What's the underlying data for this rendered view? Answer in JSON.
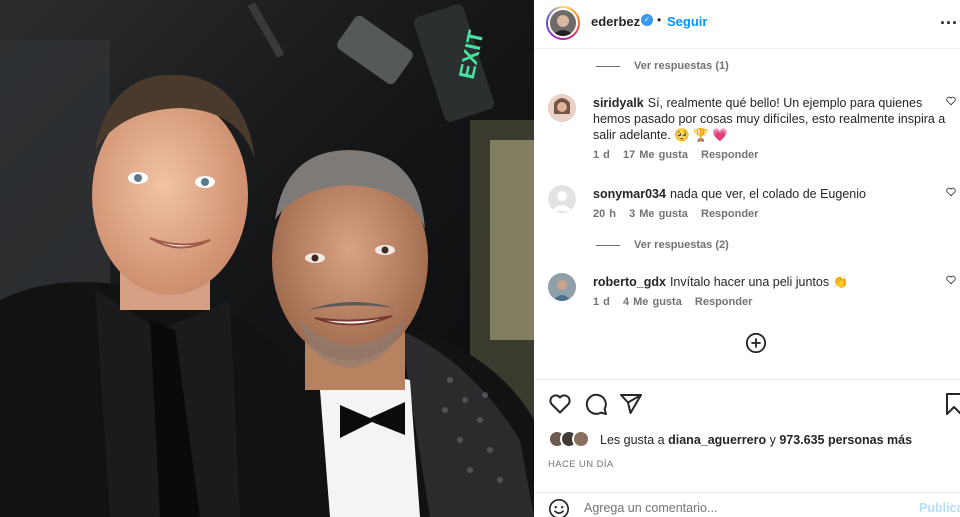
{
  "header": {
    "username": "ederbez",
    "separator": "•",
    "follow_label": "Seguir",
    "more_label": "..."
  },
  "comments": [
    {
      "replies_label": "Ver respuestas (1)"
    },
    {
      "username": "siridyalk",
      "text": "Sí, realmente qué bello! Un ejemplo para quienes hemos pasado por cosas muy difíciles, esto realmente inspira a salir adelante. 🥺 🏆 💗",
      "time": "1 d",
      "likes": "17 Me gusta",
      "reply": "Responder"
    },
    {
      "username": "sonymar034",
      "text": "nada que ver, el colado de Eugenio",
      "time": "20 h",
      "likes": "3 Me gusta",
      "reply": "Responder"
    },
    {
      "replies_label": "Ver respuestas (2)"
    },
    {
      "username": "roberto_gdx",
      "text": "Invítalo hacer una peli juntos 👏",
      "time": "1 d",
      "likes": "4 Me gusta",
      "reply": "Responder"
    }
  ],
  "likes": {
    "prefix": "Les gusta a",
    "user": "diana_aguerrero",
    "middle": "y",
    "count": "973.635 personas más"
  },
  "time_ago": "HACE UN DÍA",
  "composer": {
    "placeholder": "Agrega un comentario...",
    "publish_label": "Publica"
  },
  "icons": [
    "heart-icon",
    "comment-icon",
    "share-icon",
    "bookmark-icon",
    "add-circle-icon",
    "emoji-icon",
    "verified-icon",
    "more-icon"
  ],
  "colors": {
    "follow": "#0095f6",
    "secondary_text": "#737373",
    "verified": "#3897f0",
    "publish_disabled": "#b2dffc"
  }
}
